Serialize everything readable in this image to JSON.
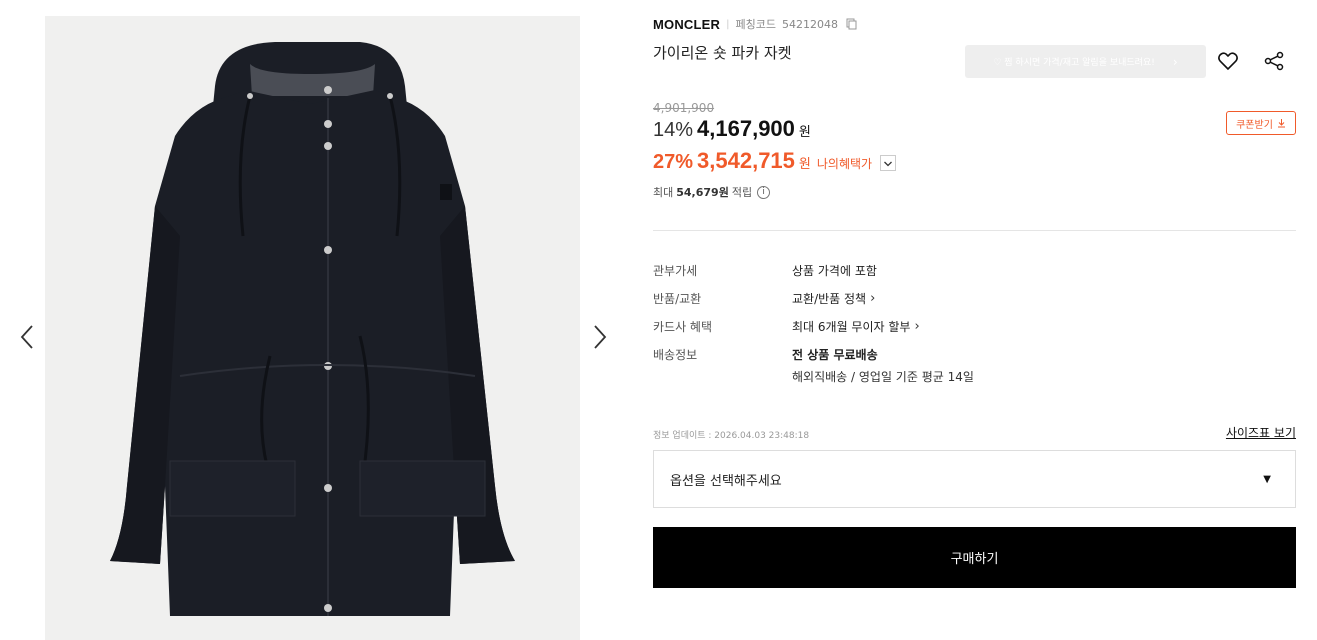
{
  "product": {
    "brand": "MONCLER",
    "code_label": "페칭코드",
    "code_value": "54212048",
    "title": "가이리온 숏 파카 자켓"
  },
  "actions": {
    "alert_text": "♡ 찜 하시면 가격/재고 알림을 보내드려요!",
    "alert_chevron": "›"
  },
  "pricing": {
    "original": "4,901,900",
    "discount1": "14%",
    "price1": "4,167,900",
    "won1": "원",
    "coupon_label": "쿠폰받기",
    "discount2": "27%",
    "price2": "3,542,715",
    "won2": "원",
    "benefit_label": "나의혜택가",
    "points_prefix": "최대",
    "points_amount": "54,679원",
    "points_suffix": "적립",
    "info_glyph": "i"
  },
  "info": {
    "rows": [
      {
        "label": "관부가세",
        "value": "상품 가격에 포함"
      },
      {
        "label": "반품/교환",
        "value": "교환/반품 정책"
      },
      {
        "label": "카드사 혜택",
        "value": "최대 6개월 무이자 할부"
      },
      {
        "label": "배송정보",
        "value": "전 상품 무료배송"
      }
    ],
    "shipping_sub": "해외직배송 / 영업일 기준 평균 14일",
    "arrow": "›"
  },
  "update_text": "정보 업데이트 : 2026.04.03 23:48:18",
  "size_chart_label": "사이즈표 보기",
  "option_placeholder": "옵션을 선택해주세요",
  "option_caret": "▼",
  "buy_label": "구매하기",
  "icons": {
    "prev": "chevron-left-icon",
    "next": "chevron-right-icon",
    "heart": "heart-icon",
    "share": "share-icon",
    "copy": "copy-icon",
    "download": "download-icon",
    "chevron_down": "chevron-down-icon",
    "info": "info-icon"
  },
  "colors": {
    "accent": "#f05a2a",
    "buy_button": "#000000",
    "gallery_bg": "#f0f0ef",
    "jacket": "#1b1e26"
  }
}
